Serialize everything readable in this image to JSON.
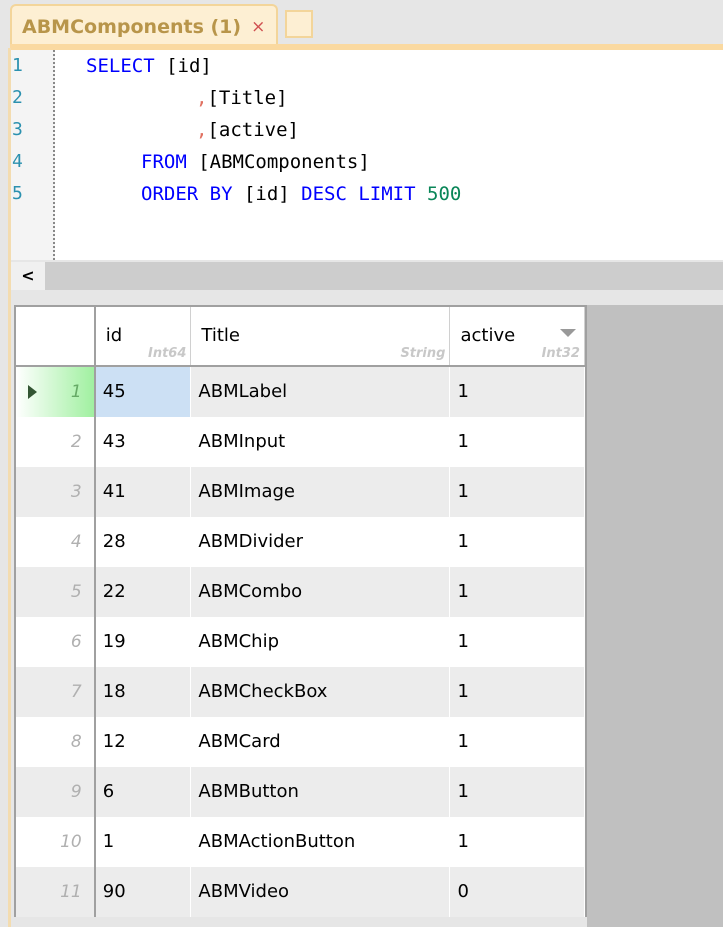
{
  "tab": {
    "title": "ABMComponents (1)",
    "close": "×"
  },
  "editor": {
    "line_numbers": [
      "1",
      "2",
      "3",
      "4",
      "5"
    ],
    "lines": [
      [
        {
          "t": "SELECT",
          "k": "kw"
        },
        {
          "t": " [id]",
          "k": ""
        }
      ],
      [
        {
          "t": ",",
          "k": "cm"
        },
        {
          "t": "[Title]",
          "k": ""
        }
      ],
      [
        {
          "t": ",",
          "k": "cm"
        },
        {
          "t": "[active]",
          "k": ""
        }
      ],
      [
        {
          "t": "FROM",
          "k": "kw"
        },
        {
          "t": " [ABMComponents]",
          "k": ""
        }
      ],
      [
        {
          "t": "ORDER BY",
          "k": "kw"
        },
        {
          "t": " [id] ",
          "k": ""
        },
        {
          "t": "DESC LIMIT",
          "k": "kw"
        },
        {
          "t": " ",
          "k": ""
        },
        {
          "t": "500",
          "k": "num"
        }
      ]
    ]
  },
  "scroll": {
    "left": "<"
  },
  "grid": {
    "columns": [
      {
        "name": "id",
        "type": "Int64"
      },
      {
        "name": "Title",
        "type": "String"
      },
      {
        "name": "active",
        "type": "Int32"
      }
    ],
    "rows": [
      [
        "1",
        "45",
        "ABMLabel",
        "1"
      ],
      [
        "2",
        "43",
        "ABMInput",
        "1"
      ],
      [
        "3",
        "41",
        "ABMImage",
        "1"
      ],
      [
        "4",
        "28",
        "ABMDivider",
        "1"
      ],
      [
        "5",
        "22",
        "ABMCombo",
        "1"
      ],
      [
        "6",
        "19",
        "ABMChip",
        "1"
      ],
      [
        "7",
        "18",
        "ABMCheckBox",
        "1"
      ],
      [
        "8",
        "12",
        "ABMCard",
        "1"
      ],
      [
        "9",
        "6",
        "ABMButton",
        "1"
      ],
      [
        "10",
        "1",
        "ABMActionButton",
        "1"
      ],
      [
        "11",
        "90",
        "ABMVideo",
        "0"
      ]
    ]
  }
}
